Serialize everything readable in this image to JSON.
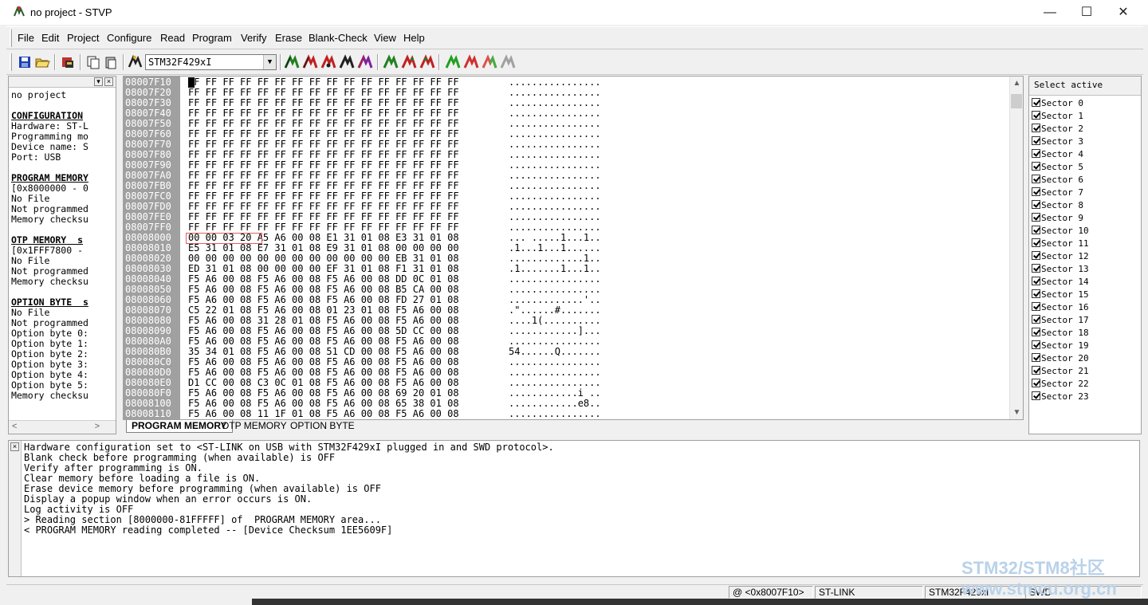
{
  "window": {
    "title": "no project - STVP",
    "minimize": "—",
    "maximize": "☐",
    "close": "✕"
  },
  "menu": [
    "File",
    "Edit",
    "Project",
    "Configure",
    "Read",
    "Program",
    "Verify",
    "Erase",
    "Blank-Check",
    "View",
    "Help"
  ],
  "toolbar": {
    "device": "STM32F429xI"
  },
  "left_panel": {
    "lines": [
      {
        "t": "no project",
        "h": false
      },
      {
        "t": "",
        "h": false
      },
      {
        "t": "CONFIGURATION",
        "h": true
      },
      {
        "t": "Hardware: ST-L",
        "h": false
      },
      {
        "t": "Programming mo",
        "h": false
      },
      {
        "t": "Device name: S",
        "h": false
      },
      {
        "t": "Port: USB",
        "h": false
      },
      {
        "t": "",
        "h": false
      },
      {
        "t": "PROGRAM MEMORY",
        "h": true
      },
      {
        "t": "[0x8000000 - 0",
        "h": false
      },
      {
        "t": "No File",
        "h": false
      },
      {
        "t": "Not programmed",
        "h": false
      },
      {
        "t": "Memory checksu",
        "h": false
      },
      {
        "t": "",
        "h": false
      },
      {
        "t": "OTP MEMORY  s",
        "h": true
      },
      {
        "t": "[0x1FFF7800 -",
        "h": false
      },
      {
        "t": "No File",
        "h": false
      },
      {
        "t": "Not programmed",
        "h": false
      },
      {
        "t": "Memory checksu",
        "h": false
      },
      {
        "t": "",
        "h": false
      },
      {
        "t": "OPTION BYTE  s",
        "h": true
      },
      {
        "t": "No File",
        "h": false
      },
      {
        "t": "Not programmed",
        "h": false
      },
      {
        "t": "Option byte 0:",
        "h": false
      },
      {
        "t": "Option byte 1:",
        "h": false
      },
      {
        "t": "Option byte 2:",
        "h": false
      },
      {
        "t": "Option byte 3:",
        "h": false
      },
      {
        "t": "Option byte 4:",
        "h": false
      },
      {
        "t": "Option byte 5:",
        "h": false
      },
      {
        "t": "Memory checksu",
        "h": false
      }
    ]
  },
  "hex": {
    "rows": [
      {
        "a": "08007F10",
        "b": "FF FF FF FF FF FF FF FF FF FF FF FF FF FF FF FF",
        "c": "................"
      },
      {
        "a": "08007F20",
        "b": "FF FF FF FF FF FF FF FF FF FF FF FF FF FF FF FF",
        "c": "................"
      },
      {
        "a": "08007F30",
        "b": "FF FF FF FF FF FF FF FF FF FF FF FF FF FF FF FF",
        "c": "................"
      },
      {
        "a": "08007F40",
        "b": "FF FF FF FF FF FF FF FF FF FF FF FF FF FF FF FF",
        "c": "................"
      },
      {
        "a": "08007F50",
        "b": "FF FF FF FF FF FF FF FF FF FF FF FF FF FF FF FF",
        "c": "................"
      },
      {
        "a": "08007F60",
        "b": "FF FF FF FF FF FF FF FF FF FF FF FF FF FF FF FF",
        "c": "................"
      },
      {
        "a": "08007F70",
        "b": "FF FF FF FF FF FF FF FF FF FF FF FF FF FF FF FF",
        "c": "................"
      },
      {
        "a": "08007F80",
        "b": "FF FF FF FF FF FF FF FF FF FF FF FF FF FF FF FF",
        "c": "................"
      },
      {
        "a": "08007F90",
        "b": "FF FF FF FF FF FF FF FF FF FF FF FF FF FF FF FF",
        "c": "................"
      },
      {
        "a": "08007FA0",
        "b": "FF FF FF FF FF FF FF FF FF FF FF FF FF FF FF FF",
        "c": "................"
      },
      {
        "a": "08007FB0",
        "b": "FF FF FF FF FF FF FF FF FF FF FF FF FF FF FF FF",
        "c": "................"
      },
      {
        "a": "08007FC0",
        "b": "FF FF FF FF FF FF FF FF FF FF FF FF FF FF FF FF",
        "c": "................"
      },
      {
        "a": "08007FD0",
        "b": "FF FF FF FF FF FF FF FF FF FF FF FF FF FF FF FF",
        "c": "................"
      },
      {
        "a": "08007FE0",
        "b": "FF FF FF FF FF FF FF FF FF FF FF FF FF FF FF FF",
        "c": "................"
      },
      {
        "a": "08007FF0",
        "b": "FF FF FF FF FF FF FF FF FF FF FF FF FF FF FF FF",
        "c": "................"
      },
      {
        "a": "08008000",
        "b": "00 00 03 20 A5 A6 00 08 E1 31 01 08 E3 31 01 08",
        "c": "... .....1...1.."
      },
      {
        "a": "08008010",
        "b": "E5 31 01 08 E7 31 01 08 E9 31 01 08 00 00 00 00",
        "c": ".1...1...1......"
      },
      {
        "a": "08008020",
        "b": "00 00 00 00 00 00 00 00 00 00 00 00 EB 31 01 08",
        "c": ".............1.."
      },
      {
        "a": "08008030",
        "b": "ED 31 01 08 00 00 00 00 EF 31 01 08 F1 31 01 08",
        "c": ".1.......1...1.."
      },
      {
        "a": "08008040",
        "b": "F5 A6 00 08 F5 A6 00 08 F5 A6 00 08 DD 0C 01 08",
        "c": "................"
      },
      {
        "a": "08008050",
        "b": "F5 A6 00 08 F5 A6 00 08 F5 A6 00 08 B5 CA 00 08",
        "c": "................"
      },
      {
        "a": "08008060",
        "b": "F5 A6 00 08 F5 A6 00 08 F5 A6 00 08 FD 27 01 08",
        "c": ".............'.."
      },
      {
        "a": "08008070",
        "b": "C5 22 01 08 F5 A6 00 08 01 23 01 08 F5 A6 00 08",
        "c": ".\"......#......."
      },
      {
        "a": "08008080",
        "b": "F5 A6 00 08 31 28 01 08 F5 A6 00 08 F5 A6 00 08",
        "c": "....1(.........."
      },
      {
        "a": "08008090",
        "b": "F5 A6 00 08 F5 A6 00 08 F5 A6 00 08 5D CC 00 08",
        "c": "............]..."
      },
      {
        "a": "080080A0",
        "b": "F5 A6 00 08 F5 A6 00 08 F5 A6 00 08 F5 A6 00 08",
        "c": "................"
      },
      {
        "a": "080080B0",
        "b": "35 34 01 08 F5 A6 00 08 51 CD 00 08 F5 A6 00 08",
        "c": "54......Q......."
      },
      {
        "a": "080080C0",
        "b": "F5 A6 00 08 F5 A6 00 08 F5 A6 00 08 F5 A6 00 08",
        "c": "................"
      },
      {
        "a": "080080D0",
        "b": "F5 A6 00 08 F5 A6 00 08 F5 A6 00 08 F5 A6 00 08",
        "c": "................"
      },
      {
        "a": "080080E0",
        "b": "D1 CC 00 08 C3 0C 01 08 F5 A6 00 08 F5 A6 00 08",
        "c": "................"
      },
      {
        "a": "080080F0",
        "b": "F5 A6 00 08 F5 A6 00 08 F5 A6 00 08 69 20 01 08",
        "c": "............i .."
      },
      {
        "a": "08008100",
        "b": "F5 A6 00 08 F5 A6 00 08 F5 A6 00 08 65 38 01 08",
        "c": "............e8.."
      },
      {
        "a": "08008110",
        "b": "F5 A6 00 08 11 1F 01 08 F5 A6 00 08 F5 A6 00 08",
        "c": "................"
      }
    ]
  },
  "tabs": [
    "PROGRAM MEMORY",
    "OTP MEMORY",
    "OPTION BYTE"
  ],
  "right_panel": {
    "header": "Select active",
    "sectors": [
      "Sector 0",
      "Sector 1",
      "Sector 2",
      "Sector 3",
      "Sector 4",
      "Sector 5",
      "Sector 6",
      "Sector 7",
      "Sector 8",
      "Sector 9",
      "Sector 10",
      "Sector 11",
      "Sector 12",
      "Sector 13",
      "Sector 14",
      "Sector 15",
      "Sector 16",
      "Sector 17",
      "Sector 18",
      "Sector 19",
      "Sector 20",
      "Sector 21",
      "Sector 22",
      "Sector 23"
    ]
  },
  "log": {
    "lines": [
      "Hardware configuration set to <ST-LINK on USB with STM32F429xI plugged in and SWD protocol>.",
      "Blank check before programming (when available) is OFF",
      "Verify after programming is ON.",
      "Clear memory before loading a file is ON.",
      "Erase device memory before programming (when available) is OFF",
      "Display a popup window when an error occurs is ON.",
      "Log activity is OFF",
      "> Reading section [8000000-81FFFFF] of  PROGRAM MEMORY area...",
      "< PROGRAM MEMORY reading completed -- [Device Checksum 1EE5609F]"
    ]
  },
  "status": {
    "address": "@ <0x8007F10>",
    "hardware": "ST-LINK",
    "device": "STM32F429xI",
    "protocol": "SWD"
  },
  "watermark": {
    "line1": "STM32/STM8社区",
    "line2": "www.stmcu.org.cn"
  },
  "colors": {
    "address_bg": "#a0a0a0",
    "selection_border": "#e06060",
    "watermark": "#b9d2ea"
  }
}
